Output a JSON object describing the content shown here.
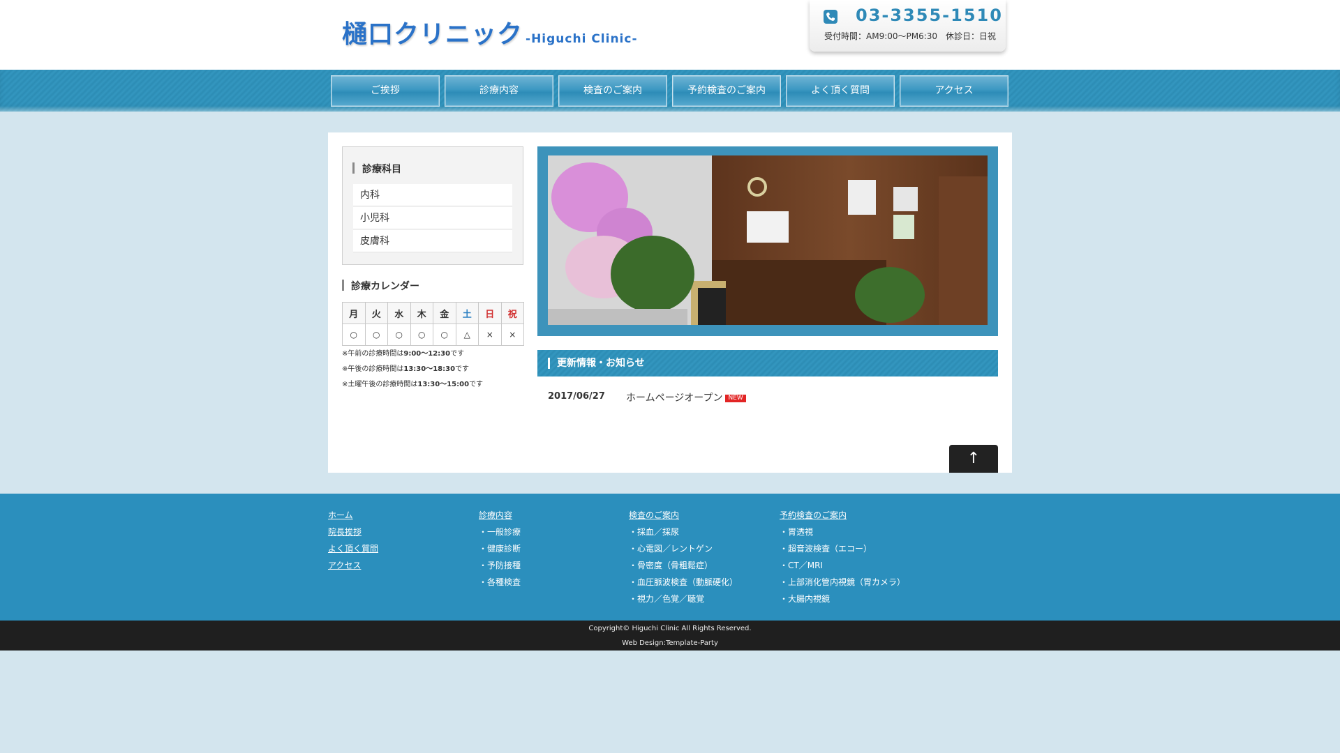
{
  "header": {
    "logo_jp": "樋口クリニック",
    "logo_en": "-Higuchi Clinic-",
    "phone": "03-3355-1510",
    "hours": "受付時間：AM9:00～PM6:30　休診日：日祝"
  },
  "nav": {
    "items": [
      {
        "label": "ご挨拶"
      },
      {
        "label": "診療内容"
      },
      {
        "label": "検査のご案内"
      },
      {
        "label": "予約検査のご案内"
      },
      {
        "label": "よく頂く質問"
      },
      {
        "label": "アクセス"
      }
    ]
  },
  "sidebar": {
    "title": "診療科目",
    "items": [
      {
        "label": "内科"
      },
      {
        "label": "小児科"
      },
      {
        "label": "皮膚科"
      }
    ]
  },
  "calendar": {
    "title": "診療カレンダー",
    "days": [
      "月",
      "火",
      "水",
      "木",
      "金",
      "土",
      "日",
      "祝"
    ],
    "marks": [
      "○",
      "○",
      "○",
      "○",
      "○",
      "△",
      "×",
      "×"
    ],
    "notes": [
      {
        "prefix": "※午前の診療時間は",
        "time": "9:00～12:30",
        "suffix": "です"
      },
      {
        "prefix": "※午後の診療時間は",
        "time": "13:30～18:30",
        "suffix": "です"
      },
      {
        "prefix": "※土曜午後の診療時間は",
        "time": "13:30～15:00",
        "suffix": "です"
      }
    ]
  },
  "news": {
    "title": "更新情報・お知らせ",
    "items": [
      {
        "date": "2017/06/27",
        "text": "ホームページオープン",
        "badge": "NEW"
      }
    ]
  },
  "top_button": {
    "label": "↑"
  },
  "footer": {
    "columns": [
      {
        "links": [
          "ホーム",
          "院長挨拶",
          "よく頂く質問",
          "アクセス"
        ],
        "items": []
      },
      {
        "links": [
          "診療内容"
        ],
        "items": [
          "・一般診療",
          "・健康診断",
          "・予防接種",
          "・各種検査"
        ]
      },
      {
        "links": [
          "検査のご案内"
        ],
        "items": [
          "・採血／採尿",
          "・心電図／レントゲン",
          "・骨密度（骨粗鬆症）",
          "・血圧脈波検査（動脈硬化）",
          "・視力／色覚／聴覚"
        ]
      },
      {
        "links": [
          "予約検査のご案内"
        ],
        "items": [
          "・胃透視",
          "・超音波検査（エコー）",
          "・CT／MRI",
          "・上部消化管内視鏡（胃カメラ）",
          "・大腸内視鏡"
        ]
      }
    ],
    "copyright": "Copyright© Higuchi Clinic All Rights Reserved.",
    "design": "Web Design:Template-Party"
  },
  "colors": {
    "accent": "#2b8fbd",
    "background": "#d3e5ee",
    "saturday": "#2b7fc2",
    "sunday_holiday": "#d12f2f",
    "new_badge": "#e22525"
  }
}
